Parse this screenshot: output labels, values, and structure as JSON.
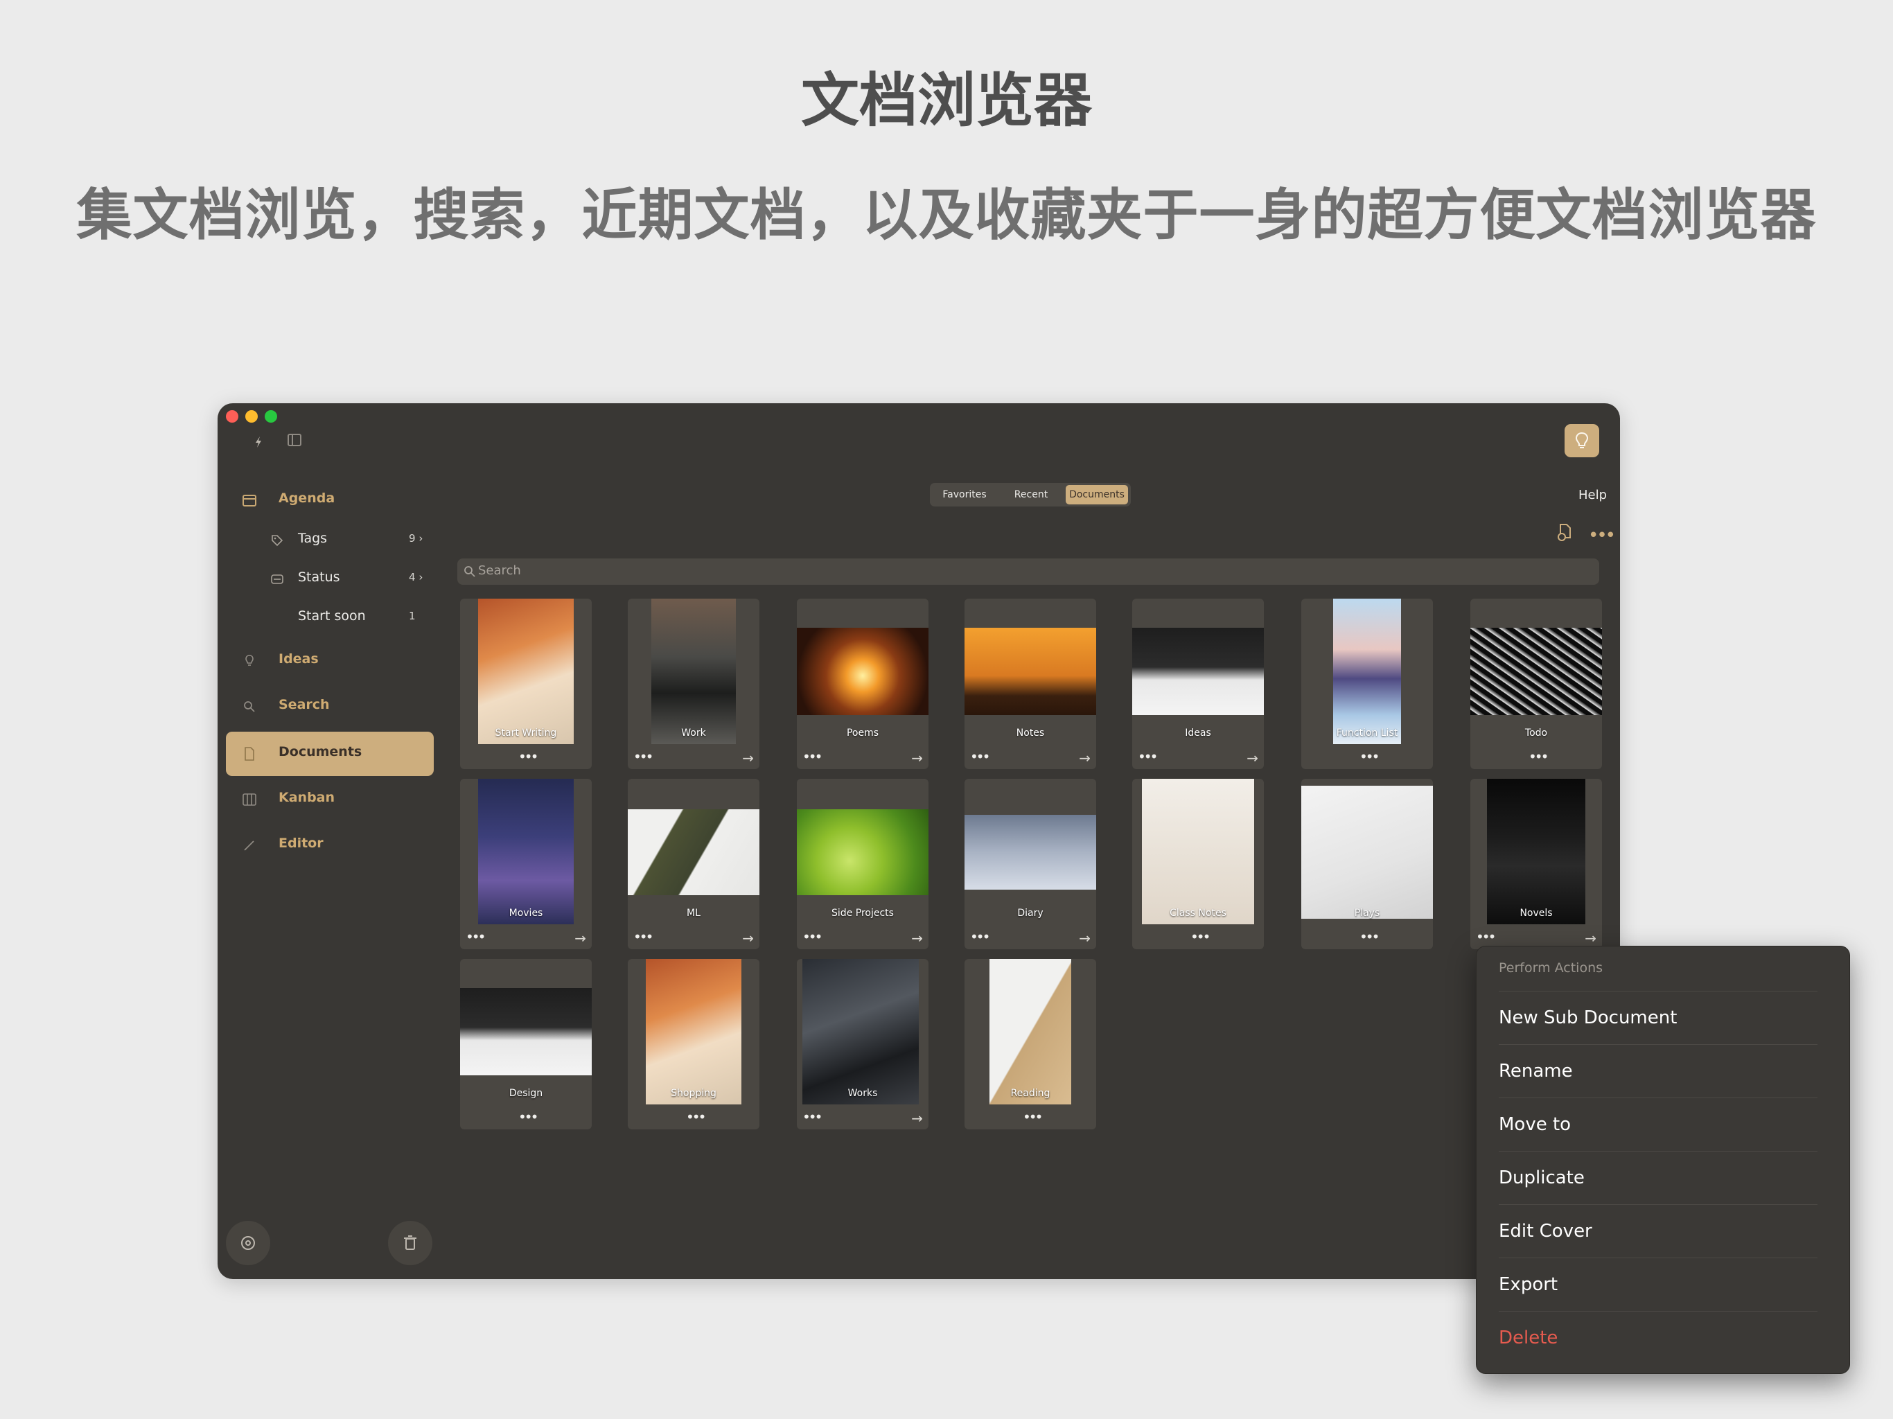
{
  "headline": "文档浏览器",
  "subline": "集文档浏览，搜索，近期文档，以及收藏夹于一身的超方便文档浏览器",
  "sidebar": {
    "items": [
      {
        "label": "Agenda",
        "icon": "calendar-icon"
      },
      {
        "label": "Tags",
        "icon": "tag-icon",
        "count": "9"
      },
      {
        "label": "Status",
        "icon": "status-icon",
        "count": "4"
      },
      {
        "label": "Start soon",
        "count": "1"
      },
      {
        "label": "Ideas",
        "icon": "lightbulb-icon"
      },
      {
        "label": "Search",
        "icon": "search-icon"
      },
      {
        "label": "Documents",
        "icon": "document-icon"
      },
      {
        "label": "Kanban",
        "icon": "kanban-icon"
      },
      {
        "label": "Editor",
        "icon": "pencil-icon"
      }
    ]
  },
  "tabs": {
    "favorites": "Favorites",
    "recent": "Recent",
    "documents": "Documents"
  },
  "help": "Help",
  "search": {
    "placeholder": "Search"
  },
  "documents": [
    {
      "name": "Start Writing",
      "arrow": false
    },
    {
      "name": "Work",
      "arrow": true
    },
    {
      "name": "Poems",
      "arrow": true
    },
    {
      "name": "Notes",
      "arrow": true
    },
    {
      "name": "Ideas",
      "arrow": true
    },
    {
      "name": "Function List",
      "arrow": false
    },
    {
      "name": "Todo",
      "arrow": false
    },
    {
      "name": "Movies",
      "arrow": true
    },
    {
      "name": "ML",
      "arrow": true
    },
    {
      "name": "Side Projects",
      "arrow": true
    },
    {
      "name": "Diary",
      "arrow": true
    },
    {
      "name": "Class Notes",
      "arrow": false
    },
    {
      "name": "Plays",
      "arrow": false
    },
    {
      "name": "Novels",
      "arrow": true
    },
    {
      "name": "Design",
      "arrow": false
    },
    {
      "name": "Shopping",
      "arrow": false
    },
    {
      "name": "Works",
      "arrow": true
    },
    {
      "name": "Reading",
      "arrow": false
    }
  ],
  "menu": {
    "title": "Perform Actions",
    "items": [
      "New Sub Document",
      "Rename",
      "Move to",
      "Duplicate",
      "Edit Cover",
      "Export",
      "Delete"
    ]
  },
  "colors": {
    "accent": "#cdae7e",
    "window": "#393734",
    "delete": "#e65b4f"
  }
}
